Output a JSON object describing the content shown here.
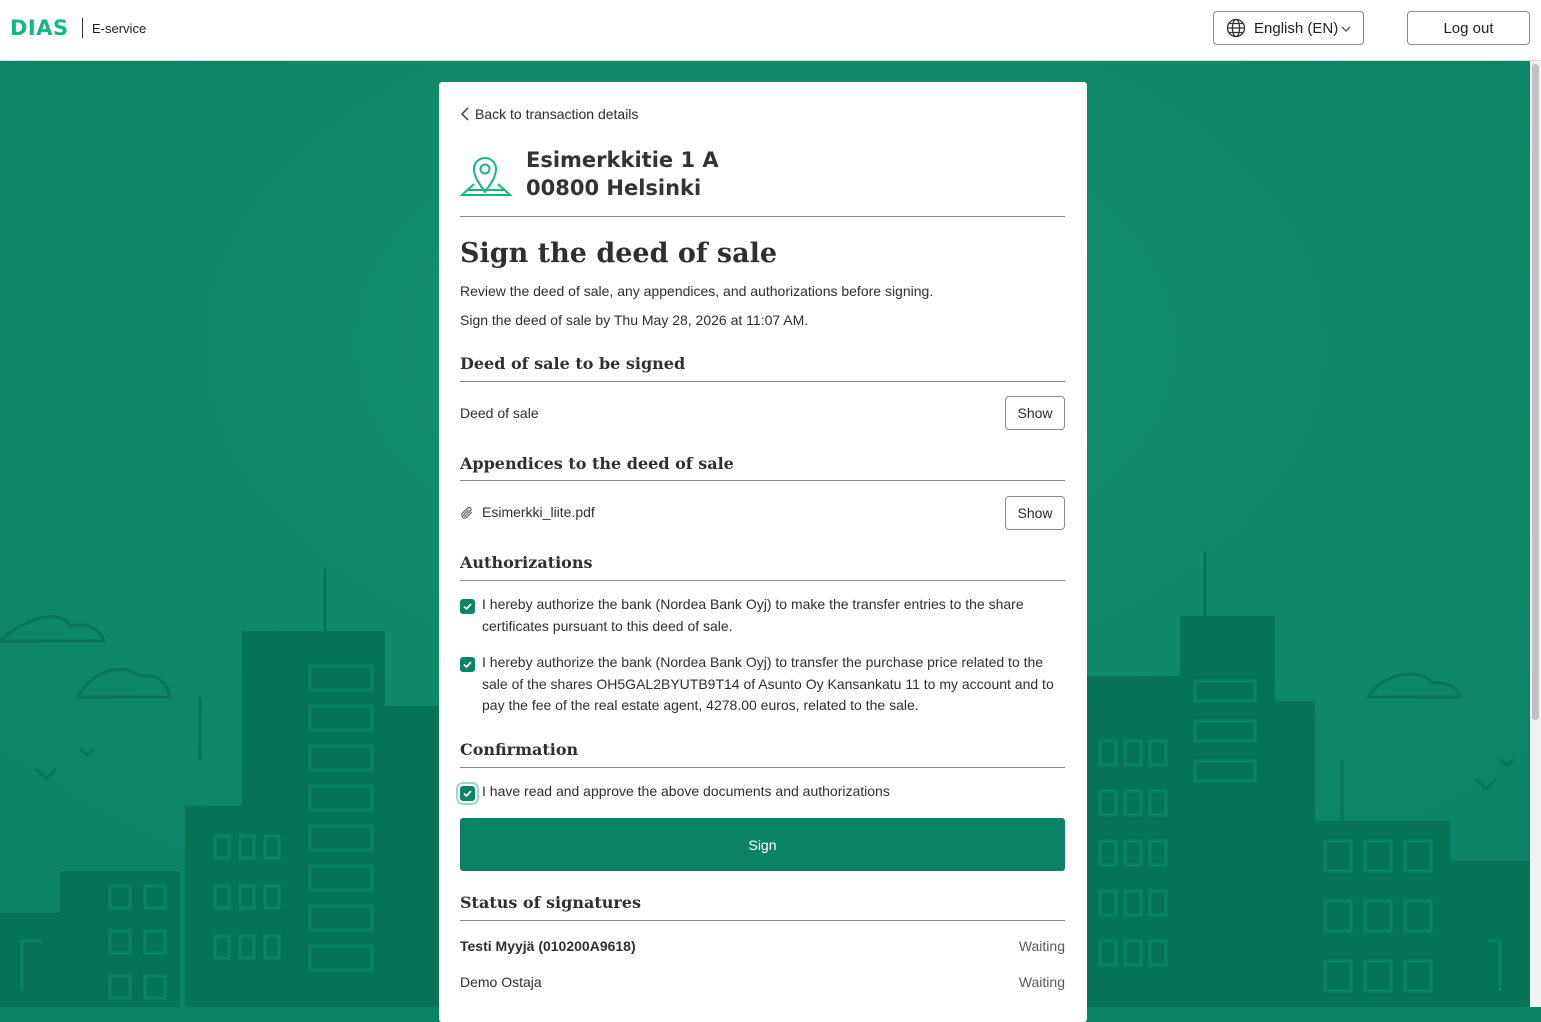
{
  "header": {
    "logo": "DIAS",
    "service_name": "E-service",
    "language": "English (EN)",
    "logout_label": "Log out"
  },
  "card": {
    "back_label": "Back to transaction details",
    "address_line1": "Esimerkkitie 1 A",
    "address_line2": "00800 Helsinki",
    "title": "Sign the deed of sale",
    "description": "Review the deed of sale, any appendices, and authorizations before signing.",
    "deadline": "Sign the deed of sale by Thu May 28, 2026 at 11:07 AM.",
    "deed_section": {
      "title": "Deed of sale to be signed",
      "item_label": "Deed of sale",
      "show_label": "Show"
    },
    "appendices_section": {
      "title": "Appendices to the deed of sale",
      "file_name": "Esimerkki_liite.pdf",
      "show_label": "Show"
    },
    "authorizations_section": {
      "title": "Authorizations",
      "items": [
        {
          "text": "I hereby authorize the bank (Nordea Bank Oyj) to make the transfer entries to the share certificates pursuant to this deed of sale.",
          "checked": true
        },
        {
          "text": "I hereby authorize the bank (Nordea Bank Oyj) to transfer the purchase price related to the sale of the shares OH5GAL2BYUTB9T14 of Asunto Oy Kansankatu 11 to my account and to pay the fee of the real estate agent, 4278.00 euros, related to the sale.",
          "checked": true
        }
      ]
    },
    "confirmation_section": {
      "title": "Confirmation",
      "text": "I have read and approve the above documents and authorizations",
      "checked": true
    },
    "sign_label": "Sign",
    "signatures_section": {
      "title": "Status of signatures",
      "rows": [
        {
          "name": "Testi Myyjä (010200A9618)",
          "status": "Waiting"
        },
        {
          "name": "Demo Ostaja",
          "status": "Waiting"
        }
      ]
    }
  },
  "colors": {
    "brand_green": "#0a8464",
    "logo_green": "#12b886",
    "illustration_dark": "#077457"
  },
  "icons": {
    "language": "globe-icon",
    "language_dropdown": "chevron-down-icon",
    "back": "chevron-left-icon",
    "address": "map-pin-icon",
    "attachment": "paperclip-icon",
    "checkbox": "check-icon"
  }
}
